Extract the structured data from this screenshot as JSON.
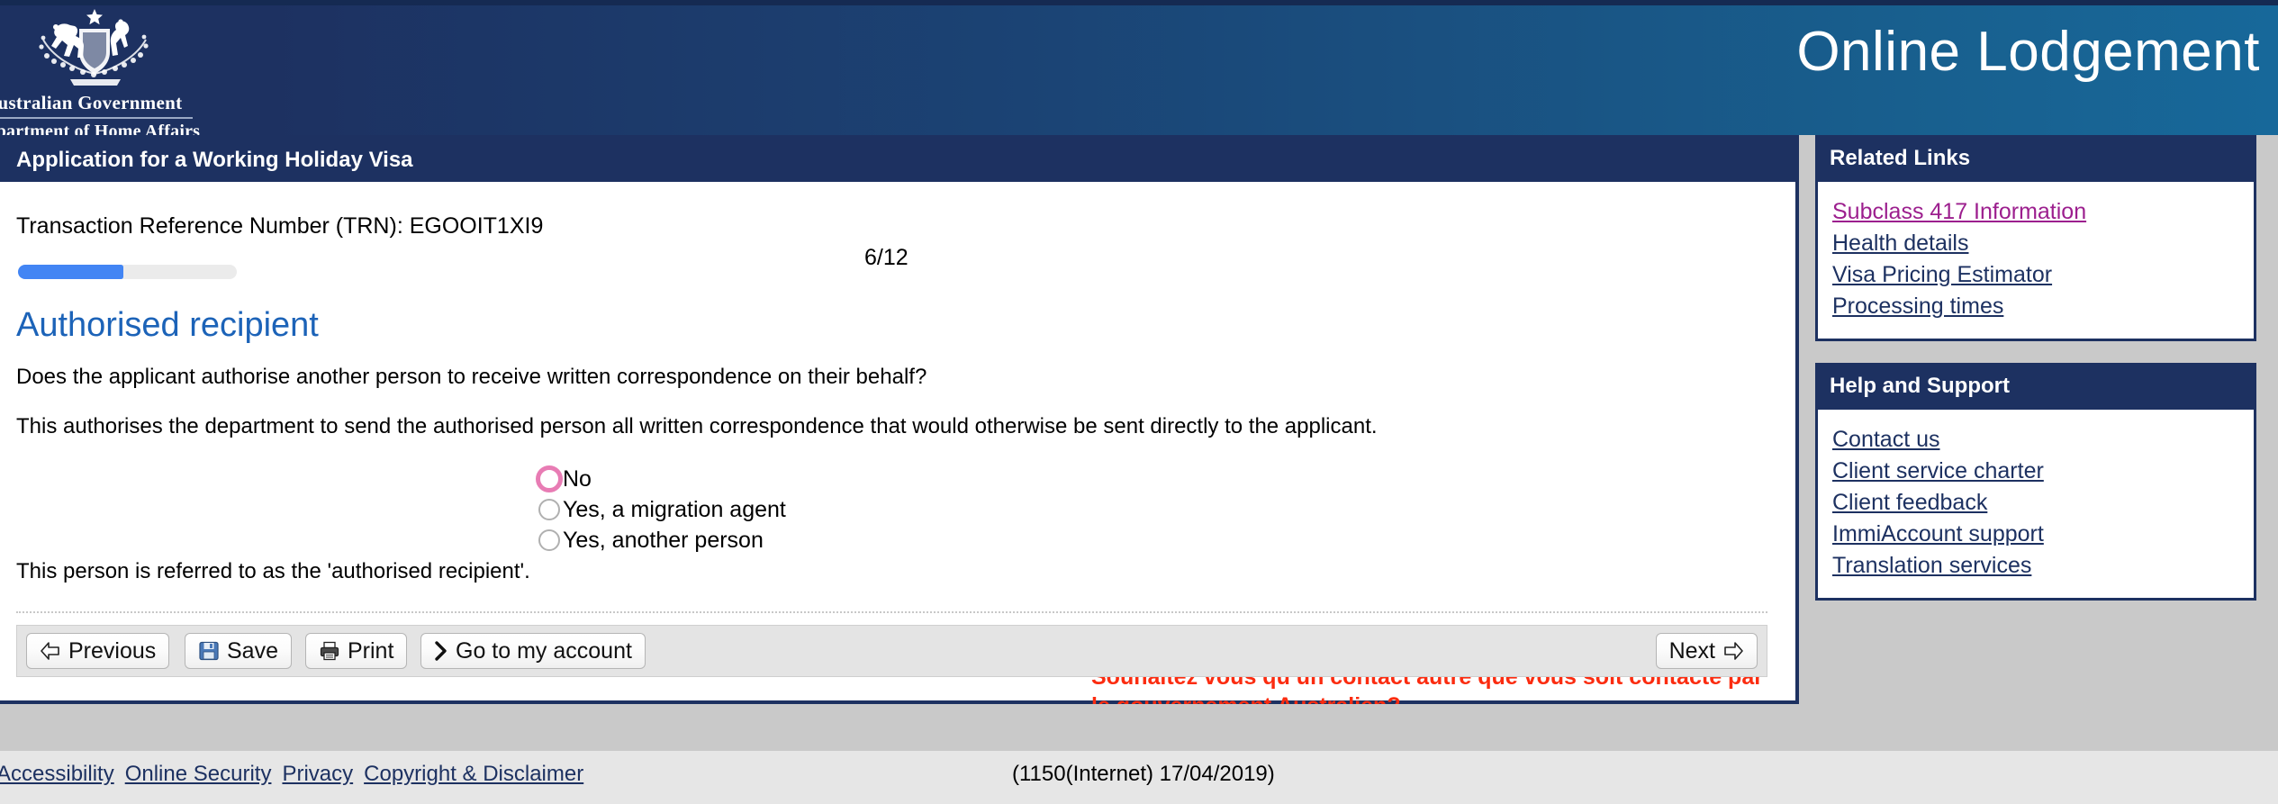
{
  "banner": {
    "coat_of_arms_alt": "australian-coat-of-arms",
    "org_line1": "Australian Government",
    "org_line2": "Department of Home Affairs",
    "app_title": "Online Lodgement",
    "gradient_start": "#1d3161",
    "gradient_end": "#17689a"
  },
  "titlebar": {
    "title": "Application for a Working Holiday Visa"
  },
  "form": {
    "trn_text": "Transaction Reference Number (TRN): EGOOIT1XI9",
    "page_counter": "6/12",
    "progress_percent": 48,
    "progress_color": "#4285f4",
    "section_heading": "Authorised recipient",
    "question": "Does the applicant authorise another person to receive written correspondence on their behalf?",
    "explanation": "This authorises the department to send the authorised person all written correspondence that would otherwise be sent directly to the applicant.",
    "referred_note": "This person is referred to as the 'authorised recipient'.",
    "radio_options": [
      {
        "label": "No",
        "selected": false,
        "highlighted": true
      },
      {
        "label": "Yes, a migration agent",
        "selected": false,
        "highlighted": false
      },
      {
        "label": "Yes, another person",
        "selected": false,
        "highlighted": false
      }
    ],
    "annotation": {
      "text": "Souhaitez vous qu’un contact autre que vous soit contacté par le gouvernement Australien?",
      "color": "#fb2c10"
    }
  },
  "toolbar": {
    "previous_label": "Previous",
    "save_label": "Save",
    "print_label": "Print",
    "account_label": "Go to my account",
    "next_label": "Next"
  },
  "sidebar": {
    "related_links": {
      "heading": "Related Links",
      "items": [
        {
          "label": "Subclass 417 Information",
          "visited": true
        },
        {
          "label": "Health details",
          "visited": false
        },
        {
          "label": "Visa Pricing Estimator",
          "visited": false
        },
        {
          "label": "Processing times",
          "visited": false
        }
      ]
    },
    "help_support": {
      "heading": "Help and Support",
      "items": [
        {
          "label": "Contact us",
          "visited": false
        },
        {
          "label": "Client service charter",
          "visited": false
        },
        {
          "label": "Client feedback",
          "visited": false
        },
        {
          "label": "ImmiAccount support",
          "visited": false
        },
        {
          "label": "Translation services",
          "visited": false
        }
      ]
    }
  },
  "footer": {
    "links": [
      "Accessibility",
      "Online Security",
      "Privacy",
      "Copyright & Disclaimer"
    ],
    "version": "(1150(Internet) 17/04/2019)"
  }
}
